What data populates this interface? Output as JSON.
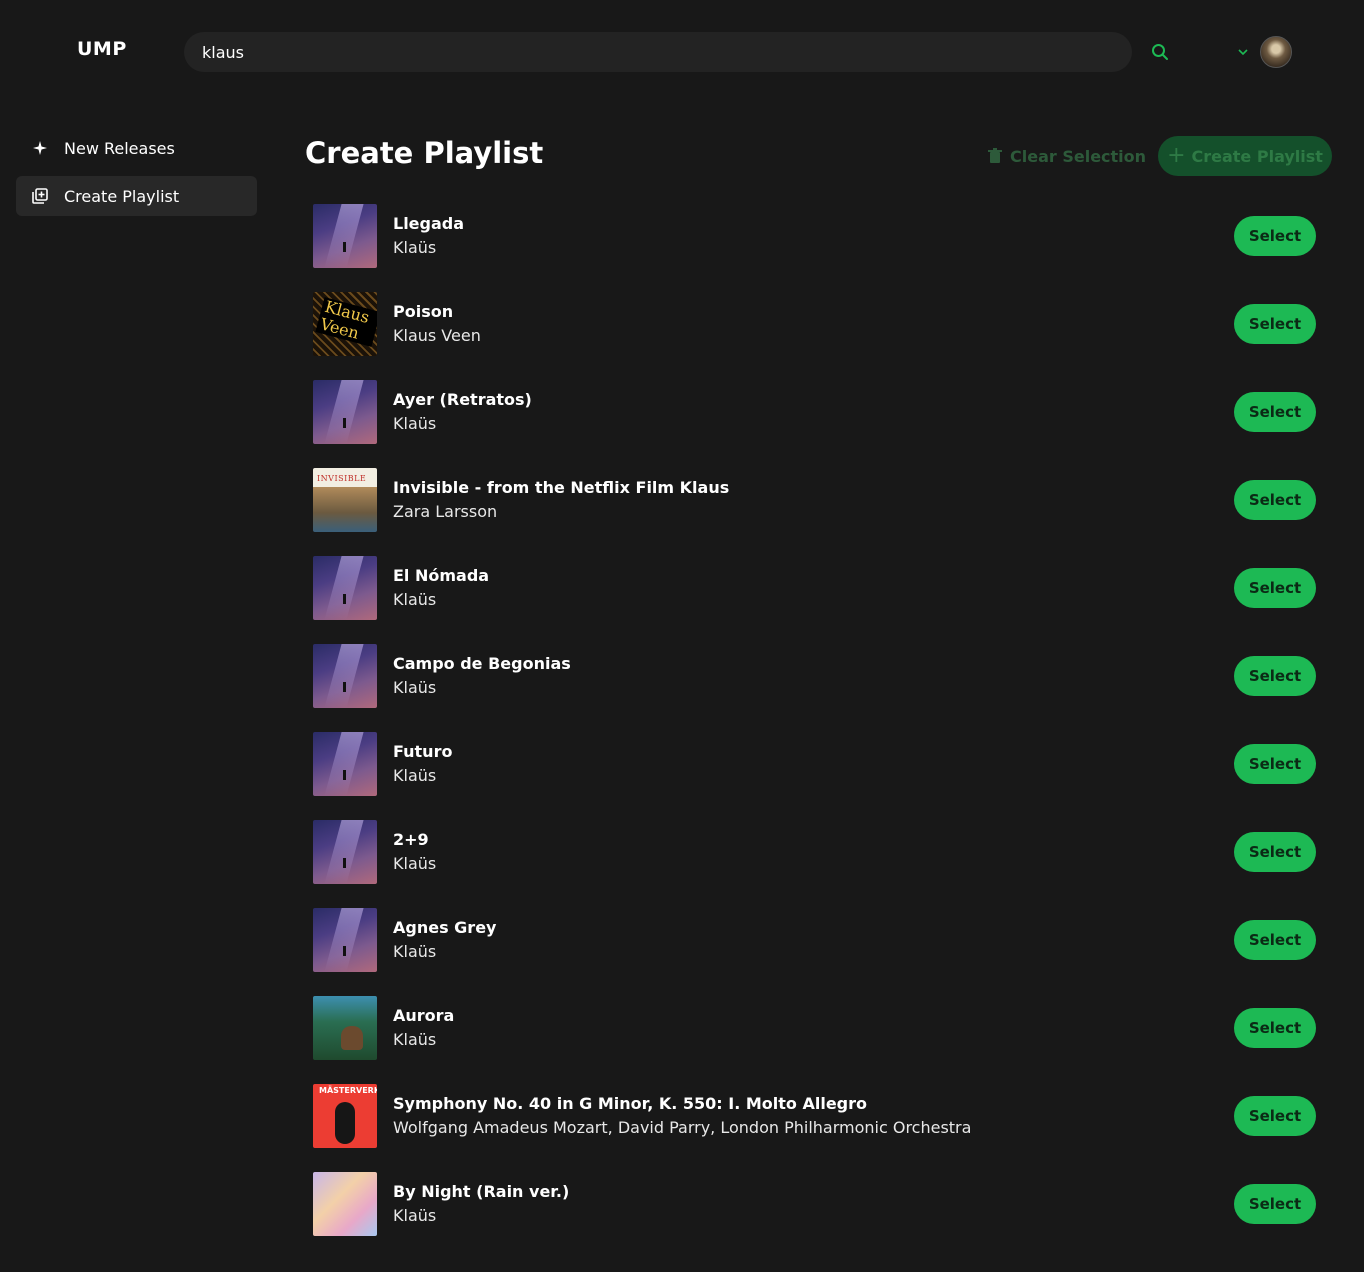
{
  "app": {
    "logo": "UMP"
  },
  "search": {
    "value": "klaus"
  },
  "sidebar": {
    "items": [
      {
        "label": "New Releases",
        "icon": "sparkle-icon",
        "active": false
      },
      {
        "label": "Create Playlist",
        "icon": "playlist-add-icon",
        "active": true
      }
    ]
  },
  "main": {
    "title": "Create Playlist",
    "clear_label": "Clear Selection",
    "create_label": "Create Playlist"
  },
  "colors": {
    "accent": "#1db954",
    "background": "#181818"
  },
  "tracks": [
    {
      "title": "Llegada",
      "artist": "Klaüs",
      "art": "art-purple",
      "select": "Select"
    },
    {
      "title": "Poison",
      "artist": "Klaus Veen",
      "art": "art-klausveen",
      "select": "Select",
      "art_text": "Klaus Veen"
    },
    {
      "title": "Ayer (Retratos)",
      "artist": "Klaüs",
      "art": "art-purple",
      "select": "Select"
    },
    {
      "title": "Invisible - from the Netflix Film Klaus",
      "artist": "Zara Larsson",
      "art": "art-invisible",
      "select": "Select",
      "art_text": "INVISIBLE"
    },
    {
      "title": "El Nómada",
      "artist": "Klaüs",
      "art": "art-purple",
      "select": "Select"
    },
    {
      "title": "Campo de Begonias",
      "artist": "Klaüs",
      "art": "art-purple",
      "select": "Select"
    },
    {
      "title": "Futuro",
      "artist": "Klaüs",
      "art": "art-purple",
      "select": "Select"
    },
    {
      "title": "2+9",
      "artist": "Klaüs",
      "art": "art-purple",
      "select": "Select"
    },
    {
      "title": "Agnes Grey",
      "artist": "Klaüs",
      "art": "art-purple",
      "select": "Select"
    },
    {
      "title": "Aurora",
      "artist": "Klaüs",
      "art": "art-aurora",
      "select": "Select"
    },
    {
      "title": "Symphony No. 40 in G Minor, K. 550: I. Molto Allegro",
      "artist": "Wolfgang Amadeus Mozart, David Parry, London Philharmonic Orchestra",
      "art": "art-mozart",
      "select": "Select",
      "art_text": "MÄSTERVERK"
    },
    {
      "title": "By Night (Rain ver.)",
      "artist": "Klaüs",
      "art": "art-bynight",
      "select": "Select"
    }
  ]
}
